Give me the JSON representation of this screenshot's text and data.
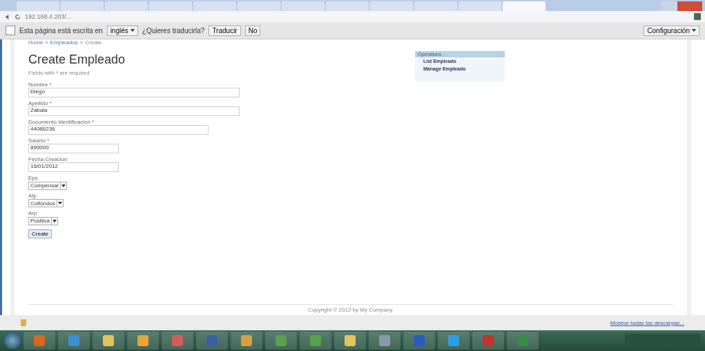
{
  "browser": {
    "tabs": [
      {
        "selected": false
      },
      {
        "selected": false
      },
      {
        "selected": false
      },
      {
        "selected": false
      },
      {
        "selected": false
      },
      {
        "selected": false
      },
      {
        "selected": false
      },
      {
        "selected": false
      },
      {
        "selected": false
      },
      {
        "selected": false
      },
      {
        "selected": false
      },
      {
        "selected": true
      }
    ],
    "url": "192.168.4.203/..."
  },
  "translate_bar": {
    "message": "Esta página está escrita en",
    "language": "inglés",
    "question": "¿Quieres traducirla?",
    "buttons": [
      "Traducir",
      "No"
    ],
    "settings": "Configuración"
  },
  "breadcrumbs": {
    "separator": "»",
    "items": [
      "Home",
      "Empleados",
      "Create"
    ]
  },
  "page": {
    "title": "Create Empleado",
    "note": "Fields with * are required.",
    "fields": [
      {
        "kind": "text",
        "label": "Nombre *",
        "value": "Diego"
      },
      {
        "kind": "text",
        "label": "Apellido *",
        "value": "Zabala"
      },
      {
        "kind": "text",
        "label": "Documento Identificacion *",
        "value": "44086236"
      },
      {
        "kind": "text",
        "label": "Salario *",
        "value": "890000"
      },
      {
        "kind": "text",
        "label": "Fecha Creacion",
        "value": "15/01/2012"
      },
      {
        "kind": "select",
        "label": "Eps",
        "value": "Compensar"
      },
      {
        "kind": "select",
        "label": "Afp",
        "value": "Colfondos"
      },
      {
        "kind": "select",
        "label": "Arp",
        "value": "Positiva"
      }
    ],
    "submit": "Create"
  },
  "operations": {
    "title": "Operations",
    "items": [
      "List Empleado",
      "Manage Empleado"
    ]
  },
  "footer": "Copyright © 2012 by My Company.",
  "download_bar": {
    "link": "Mostrar todas las descargas..."
  },
  "taskbar": {
    "apps": [
      {
        "color": "#d9661f"
      },
      {
        "color": "#3a8fd6"
      },
      {
        "color": "#e3c35a"
      },
      {
        "color": "#e8a43a"
      },
      {
        "color": "#d95a5a"
      },
      {
        "color": "#3c5fa8"
      },
      {
        "color": "#d9a03a"
      },
      {
        "color": "#5aa04a"
      },
      {
        "color": "#5aa04a"
      },
      {
        "color": "#e3c35a"
      },
      {
        "color": "#8a9aa8"
      },
      {
        "color": "#2b5bb8"
      },
      {
        "color": "#2aa0e0"
      },
      {
        "color": "#c8302a"
      },
      {
        "color": "#3a8a4a"
      }
    ]
  }
}
